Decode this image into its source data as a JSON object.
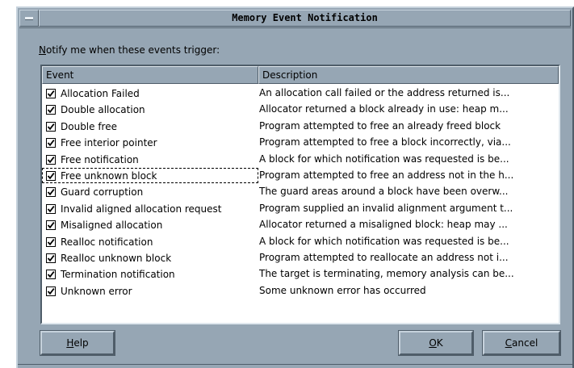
{
  "window": {
    "title": "Memory Event Notification"
  },
  "prompt": {
    "mnemonic": "N",
    "rest": "otify me when these events trigger:"
  },
  "table": {
    "columns": [
      "Event",
      "Description"
    ],
    "focused_row": 5,
    "rows": [
      {
        "checked": true,
        "event": "Allocation Failed",
        "description": "An allocation call failed or the address returned is..."
      },
      {
        "checked": true,
        "event": "Double allocation",
        "description": "Allocator returned a block already in use: heap m..."
      },
      {
        "checked": true,
        "event": "Double free",
        "description": "Program attempted to free an already freed block"
      },
      {
        "checked": true,
        "event": "Free interior pointer",
        "description": "Program attempted to free a block incorrectly, via..."
      },
      {
        "checked": true,
        "event": "Free notification",
        "description": "A block for which notification was requested is be..."
      },
      {
        "checked": true,
        "event": "Free unknown block",
        "description": "Program attempted to free an address not in the h..."
      },
      {
        "checked": true,
        "event": "Guard corruption",
        "description": "The guard areas around a block have been overw..."
      },
      {
        "checked": true,
        "event": "Invalid aligned allocation request",
        "description": "Program supplied an invalid alignment argument t..."
      },
      {
        "checked": true,
        "event": "Misaligned allocation",
        "description": "Allocator returned a misaligned block: heap may ..."
      },
      {
        "checked": true,
        "event": "Realloc notification",
        "description": "A block for which notification was requested is be..."
      },
      {
        "checked": true,
        "event": "Realloc unknown block",
        "description": "Program attempted to reallocate an address not i..."
      },
      {
        "checked": true,
        "event": "Termination notification",
        "description": "The target is terminating, memory analysis can be..."
      },
      {
        "checked": true,
        "event": "Unknown error",
        "description": "Some unknown error has occurred"
      }
    ]
  },
  "buttons": {
    "help": {
      "mnemonic": "H",
      "rest": "elp"
    },
    "ok": {
      "mnemonic": "O",
      "rest": "K"
    },
    "cancel": {
      "mnemonic": "C",
      "rest": "ancel"
    }
  }
}
